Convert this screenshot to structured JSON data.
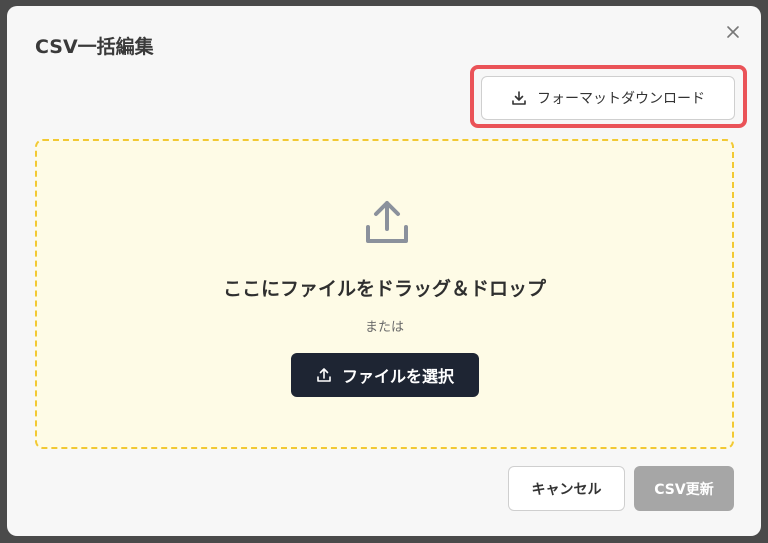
{
  "dialog": {
    "title": "CSV一括編集",
    "close_icon": "close-icon"
  },
  "format_download": {
    "label": "フォーマットダウンロード",
    "icon": "download-icon",
    "highlight_color": "#ea5358"
  },
  "dropzone": {
    "icon": "upload-icon",
    "prompt": "ここにファイルをドラッグ＆ドロップ",
    "or": "または",
    "select_label": "ファイルを選択",
    "select_icon": "upload-icon",
    "background": "#fefbe6",
    "border_color": "#f2c933"
  },
  "footer": {
    "cancel_label": "キャンセル",
    "submit_label": "CSV更新",
    "submit_disabled": true
  }
}
